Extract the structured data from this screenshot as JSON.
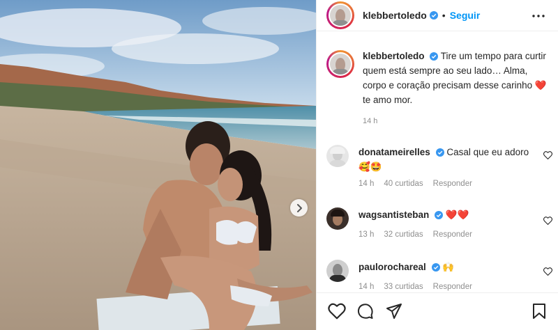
{
  "post": {
    "author": "klebbertoledo",
    "separator": "•",
    "follow_label": "Seguir",
    "caption_text": "Tire um tempo para curtir quem está sempre ao seu lado… Alma, corpo e coração precisam desse carinho",
    "caption_emoji": "❤️",
    "caption_end": "te amo mor.",
    "time": "14 h"
  },
  "comments": [
    {
      "user": "donatameirelles",
      "text": "Casal que eu adoro",
      "emojis": "🥰🤩",
      "time": "14 h",
      "likes": "40 curtidas",
      "reply": "Responder"
    },
    {
      "user": "wagsantisteban",
      "text": "",
      "emojis": "❤️❤️",
      "time": "13 h",
      "likes": "32 curtidas",
      "reply": "Responder"
    },
    {
      "user": "paulorochareal",
      "text": "",
      "emojis": "🙌",
      "time": "14 h",
      "likes": "33 curtidas",
      "reply": "Responder"
    }
  ],
  "colors": {
    "accent": "#0095f6",
    "heart": "#ed4956",
    "verified": "#3897f0"
  },
  "icons": {
    "like": "heart-icon",
    "comment": "comment-icon",
    "share": "send-icon",
    "save": "bookmark-icon",
    "more": "more-icon",
    "next": "chevron-right-icon"
  }
}
